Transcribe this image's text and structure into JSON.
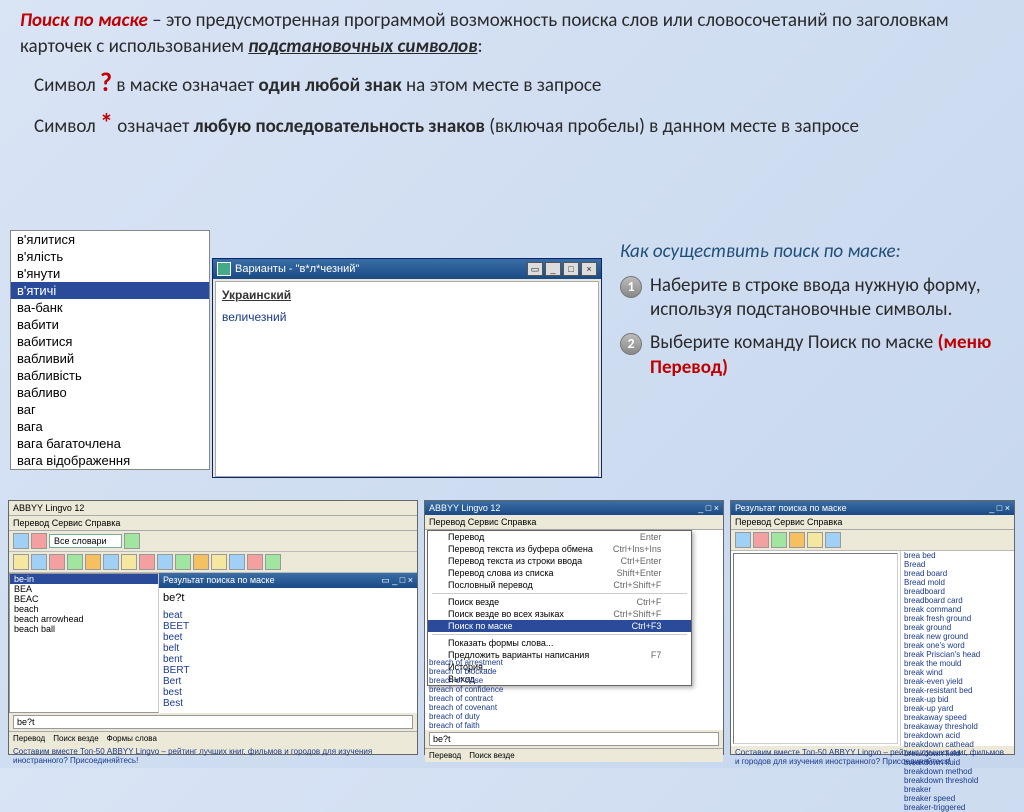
{
  "intro": {
    "term": "Поиск по маске",
    "rest1": " – это предусмотренная программой возможность поиска слов или словосочетаний по заголовкам карточек с использованием ",
    "underlined": "подстановочных символов",
    "colon": ":"
  },
  "sym1": {
    "pre": "Символ ",
    "sym": "?",
    "mid": " в маске означает ",
    "bold": "один любой знак",
    "post": " на этом месте в запросе"
  },
  "sym2": {
    "pre": "Символ ",
    "sym": "*",
    "mid": " означает ",
    "bold": "любую последовательность знаков",
    "post": " (включая пробелы) в данном месте в запросе"
  },
  "wordlist": [
    "в'ялитися",
    "в'ялість",
    "в'янути",
    "в'ятичі",
    "ва-банк",
    "вабити",
    "вабитися",
    "вабливий",
    "вабливість",
    "вабливо",
    "ваг",
    "вага",
    "вага багаточлена",
    "вага відображення"
  ],
  "wordlist_selected_index": 3,
  "variants_window": {
    "title": "Варианты - \"в*л*чезний\"",
    "lang": "Украинский",
    "result": "величезний"
  },
  "instructions": {
    "header": "Как осуществить поиск по маске:",
    "steps": [
      "Наберите в строке ввода нужную форму, используя подстановочные символы.",
      ""
    ],
    "step2_pre": "Выберите команду ",
    "step2_bold": "Поиск по маске ",
    "step2_red": "(меню Перевод)"
  },
  "shot1": {
    "title": "ABBYY Lingvo 12",
    "menu": "Перевод  Сервис  Справка",
    "dropdown": "Все словари",
    "left_items": [
      "be-in",
      "BEA",
      "BEAC",
      "beach",
      "beach arrowhead",
      "beach ball"
    ],
    "left_selected_index": 0,
    "searchbox": "be?t",
    "mask_title": "Результат поиска по маске",
    "mask_query": "be?t",
    "mask_results": [
      "beat",
      "BEET",
      "beet",
      "belt",
      "bent",
      "BERT",
      "Bert",
      "best",
      "Best"
    ],
    "status": [
      "Перевод",
      "Поиск везде",
      "Формы слова"
    ],
    "footer": "Составим вместе Топ-50 ABBYY Lingvo – рейтинг лучших книг, фильмов и городов для изучения иностранного? Присоединяйтесь!"
  },
  "shot2": {
    "title": "ABBYY Lingvo 12",
    "menu_items": [
      {
        "label": "Перевод",
        "kb": "Enter"
      },
      {
        "label": "Перевод текста из буфера обмена",
        "kb": "Ctrl+Ins+Ins"
      },
      {
        "label": "Перевод текста из строки ввода",
        "kb": "Ctrl+Enter"
      },
      {
        "label": "Перевод слова из списка",
        "kb": "Shift+Enter"
      },
      {
        "label": "Пословный перевод",
        "kb": "Ctrl+Shift+F"
      },
      {
        "label": "Поиск везде",
        "kb": "Ctrl+F"
      },
      {
        "label": "Поиск везде во всех языках",
        "kb": "Ctrl+Shift+F"
      },
      {
        "label": "Поиск по маске",
        "kb": "Ctrl+F3",
        "sel": true
      },
      {
        "label": "Показать формы слова...",
        "kb": ""
      },
      {
        "label": "Предложить варианты написания",
        "kb": "F7"
      },
      {
        "label": "История...",
        "kb": ""
      },
      {
        "label": "Выход",
        "kb": ""
      }
    ],
    "below_items": [
      "breach of arrestment",
      "breach of blockade",
      "breach of close",
      "breach of confidence",
      "breach of contract",
      "breach of covenant",
      "breach of duty",
      "breach of faith"
    ],
    "searchbox": "be?t",
    "status": [
      "Перевод",
      "Поиск везде"
    ]
  },
  "shot3": {
    "title_left": "Результат поиска по маске",
    "menu": "Перевод  Сервис  Справка",
    "right_items": [
      "brea bed",
      "Bread",
      "bread board",
      "Bread mold",
      "breadboard",
      "breadboard card",
      "break command",
      "break fresh ground",
      "break ground",
      "break new ground",
      "break one's word",
      "break Priscian's head",
      "break the mould",
      "break wind",
      "break-even yield",
      "break-resistant bed",
      "break-up bid",
      "break-up yard",
      "breakaway speed",
      "breakaway threshold",
      "breakdown acid",
      "breakdown cathead",
      "breakdown field",
      "breakdown fluid",
      "breakdown method",
      "breakdown threshold",
      "breaker",
      "breaker speed",
      "breaker-triggered"
    ],
    "footer": "Составим вместе Топ-50 ABBYY Lingvo – рейтинг лучших книг, фильмов и городов для изучения иностранного? Присоединяйтесь!"
  }
}
